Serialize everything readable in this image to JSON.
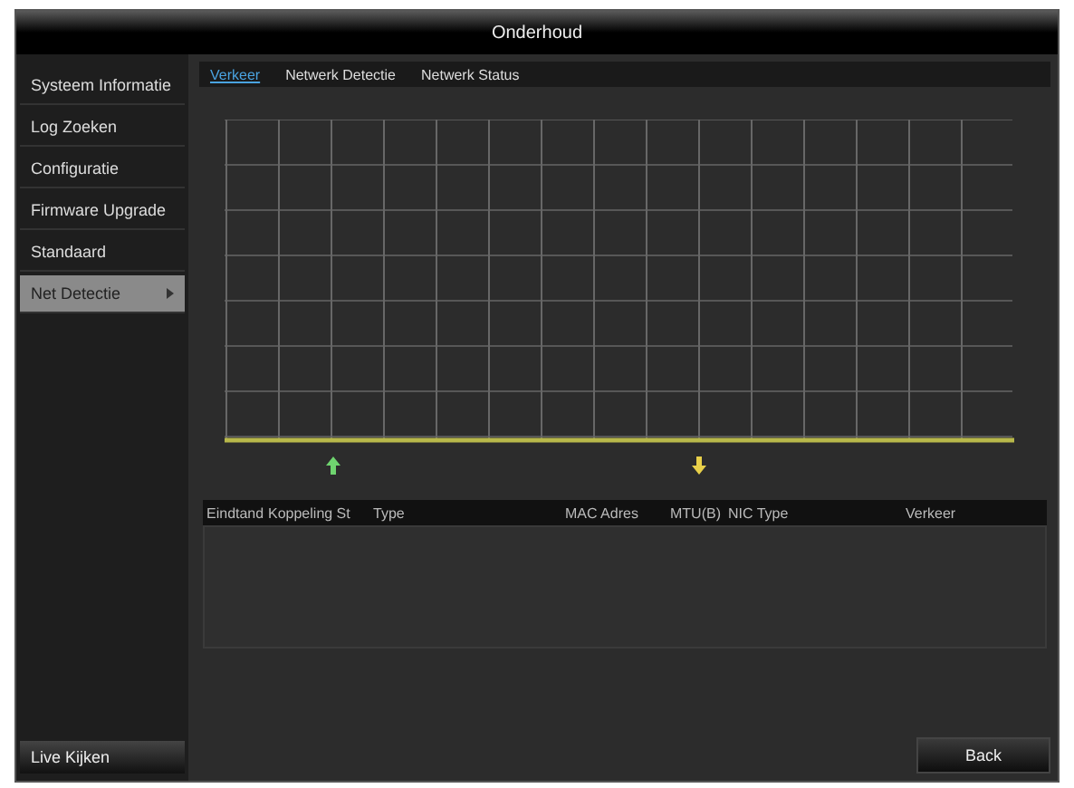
{
  "window": {
    "title": "Onderhoud"
  },
  "sidebar": {
    "items": [
      {
        "label": "Systeem Informatie",
        "selected": false,
        "has_submenu": false
      },
      {
        "label": "Log Zoeken",
        "selected": false,
        "has_submenu": false
      },
      {
        "label": "Configuratie",
        "selected": false,
        "has_submenu": false
      },
      {
        "label": "Firmware Upgrade",
        "selected": false,
        "has_submenu": false
      },
      {
        "label": "Standaard",
        "selected": false,
        "has_submenu": false
      },
      {
        "label": "Net Detectie",
        "selected": true,
        "has_submenu": true
      }
    ],
    "footer_button": "Live Kijken"
  },
  "tabs": [
    {
      "label": "Verkeer",
      "selected": true
    },
    {
      "label": "Netwerk Detectie",
      "selected": false
    },
    {
      "label": "Netwerk Status",
      "selected": false
    }
  ],
  "table": {
    "columns": [
      "Eindtand",
      "Koppeling St",
      "Type",
      "MAC Adres",
      "MTU(B)",
      "NIC Type",
      "Verkeer"
    ]
  },
  "buttons": [
    "Back"
  ]
}
